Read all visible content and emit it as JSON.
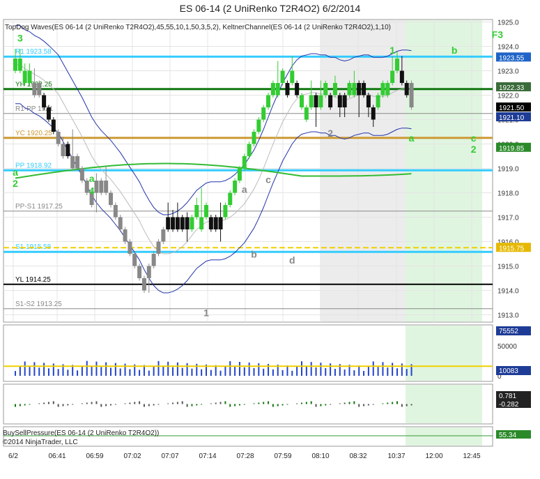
{
  "title": "ES 06-14 (2 UniRenko T2R4O2)  6/2/2014",
  "indicator_label": "TopDog Waves(ES 06-14 (2 UniRenko T2R4O2),45,55,10,1,50,3,5,2), KeltnerChannel(ES 06-14 (2 UniRenko T2R4O2),1,10)",
  "bsp_label": "BuySellPressure(ES 06-14 (2 UniRenko T2R4O2))",
  "copyright": "©2014 NinjaTrader, LLC",
  "colors": {
    "up_bar": "#33cc33",
    "down_bar": "#111111",
    "gray_bar": "#888888",
    "keltner": "#2233aa",
    "mid_line": "#777777",
    "green_ma": "#33bb33",
    "pivot_cyan": "#33ccff",
    "yc_orange": "#cc9933",
    "s1_yellow": "#f0d000",
    "volume_bar": "#2244cc",
    "session_shade": "#e0f5e0"
  },
  "chart_data": {
    "type": "candlestick",
    "title": "ES 06-14 (2 UniRenko T2R4O2)  6/2/2014",
    "x_ticks": [
      "6/2",
      "06:41",
      "06:59",
      "07:02",
      "07:07",
      "07:14",
      "07:28",
      "07:59",
      "08:10",
      "08:32",
      "10:37",
      "12:00",
      "12:45"
    ],
    "ylim": [
      1912.7,
      1925.1
    ],
    "y_ticks": [
      1913.0,
      1914.0,
      1915.0,
      1916.0,
      1917.0,
      1918.0,
      1919.0,
      1920.0,
      1921.0,
      1922.0,
      1923.0,
      1924.0,
      1925.0
    ],
    "grid": true,
    "price_bars": [
      {
        "o": 1923.0,
        "c": 1923.5,
        "h": 1923.9,
        "l": 1922.9,
        "dir": "up"
      },
      {
        "o": 1923.0,
        "c": 1923.5,
        "h": 1923.9,
        "l": 1922.9,
        "dir": "up"
      },
      {
        "o": 1922.5,
        "c": 1923.0,
        "h": 1923.3,
        "l": 1922.4,
        "dir": "up"
      },
      {
        "o": 1922.5,
        "c": 1923.0,
        "h": 1923.3,
        "l": 1922.4,
        "dir": "up"
      },
      {
        "o": 1922.0,
        "c": 1922.5,
        "h": 1923.1,
        "l": 1921.9,
        "dir": "gray"
      },
      {
        "o": 1922.0,
        "c": 1922.5,
        "h": 1922.6,
        "l": 1921.9,
        "dir": "gray"
      },
      {
        "o": 1921.5,
        "c": 1922.0,
        "h": 1922.1,
        "l": 1921.4,
        "dir": "down"
      },
      {
        "o": 1921.0,
        "c": 1921.5,
        "h": 1921.6,
        "l": 1920.9,
        "dir": "down"
      },
      {
        "o": 1920.5,
        "c": 1921.0,
        "h": 1921.1,
        "l": 1920.4,
        "dir": "down"
      },
      {
        "o": 1920.0,
        "c": 1920.5,
        "h": 1920.6,
        "l": 1919.9,
        "dir": "gray"
      },
      {
        "o": 1919.5,
        "c": 1920.0,
        "h": 1920.3,
        "l": 1919.4,
        "dir": "gray"
      },
      {
        "o": 1919.5,
        "c": 1920.0,
        "h": 1920.1,
        "l": 1919.4,
        "dir": "down"
      },
      {
        "o": 1919.0,
        "c": 1919.5,
        "h": 1920.6,
        "l": 1918.9,
        "dir": "gray"
      },
      {
        "o": 1919.0,
        "c": 1919.5,
        "h": 1919.6,
        "l": 1918.9,
        "dir": "gray"
      },
      {
        "o": 1918.5,
        "c": 1919.0,
        "h": 1919.1,
        "l": 1918.4,
        "dir": "gray"
      },
      {
        "o": 1918.0,
        "c": 1918.5,
        "h": 1918.6,
        "l": 1917.9,
        "dir": "gray"
      },
      {
        "o": 1917.5,
        "c": 1918.0,
        "h": 1918.1,
        "l": 1917.4,
        "dir": "gray"
      },
      {
        "o": 1918.0,
        "c": 1918.5,
        "h": 1918.8,
        "l": 1917.2,
        "dir": "gray"
      },
      {
        "o": 1918.0,
        "c": 1918.5,
        "h": 1918.6,
        "l": 1917.9,
        "dir": "gray"
      },
      {
        "o": 1918.0,
        "c": 1918.5,
        "h": 1919.1,
        "l": 1917.9,
        "dir": "gray"
      },
      {
        "o": 1917.5,
        "c": 1918.0,
        "h": 1918.1,
        "l": 1917.4,
        "dir": "gray"
      },
      {
        "o": 1917.0,
        "c": 1917.5,
        "h": 1917.6,
        "l": 1916.9,
        "dir": "gray"
      },
      {
        "o": 1916.5,
        "c": 1917.0,
        "h": 1917.1,
        "l": 1916.4,
        "dir": "gray"
      },
      {
        "o": 1916.0,
        "c": 1916.5,
        "h": 1916.6,
        "l": 1915.9,
        "dir": "gray"
      },
      {
        "o": 1915.5,
        "c": 1916.0,
        "h": 1916.1,
        "l": 1915.4,
        "dir": "gray"
      },
      {
        "o": 1915.0,
        "c": 1915.5,
        "h": 1915.6,
        "l": 1914.9,
        "dir": "gray"
      },
      {
        "o": 1914.5,
        "c": 1915.0,
        "h": 1915.1,
        "l": 1914.4,
        "dir": "gray"
      },
      {
        "o": 1914.0,
        "c": 1914.5,
        "h": 1914.6,
        "l": 1913.9,
        "dir": "gray"
      },
      {
        "o": 1914.5,
        "c": 1915.0,
        "h": 1915.1,
        "l": 1913.9,
        "dir": "gray"
      },
      {
        "o": 1915.0,
        "c": 1915.5,
        "h": 1915.6,
        "l": 1914.9,
        "dir": "gray"
      },
      {
        "o": 1915.5,
        "c": 1916.0,
        "h": 1916.1,
        "l": 1915.4,
        "dir": "gray"
      },
      {
        "o": 1916.0,
        "c": 1916.5,
        "h": 1916.6,
        "l": 1915.9,
        "dir": "gray"
      },
      {
        "o": 1916.5,
        "c": 1917.0,
        "h": 1917.6,
        "l": 1916.4,
        "dir": "down"
      },
      {
        "o": 1916.5,
        "c": 1917.0,
        "h": 1917.3,
        "l": 1916.4,
        "dir": "down"
      },
      {
        "o": 1916.5,
        "c": 1917.0,
        "h": 1917.6,
        "l": 1916.4,
        "dir": "down"
      },
      {
        "o": 1916.5,
        "c": 1917.0,
        "h": 1917.1,
        "l": 1916.4,
        "dir": "down"
      },
      {
        "o": 1916.5,
        "c": 1917.0,
        "h": 1917.2,
        "l": 1916.0,
        "dir": "down"
      },
      {
        "o": 1916.5,
        "c": 1917.0,
        "h": 1917.1,
        "l": 1916.4,
        "dir": "up"
      },
      {
        "o": 1917.0,
        "c": 1917.5,
        "h": 1917.8,
        "l": 1916.9,
        "dir": "up"
      },
      {
        "o": 1916.5,
        "c": 1917.0,
        "h": 1918.2,
        "l": 1916.4,
        "dir": "up"
      },
      {
        "o": 1917.0,
        "c": 1917.5,
        "h": 1917.6,
        "l": 1916.9,
        "dir": "up"
      },
      {
        "o": 1916.5,
        "c": 1917.0,
        "h": 1917.1,
        "l": 1916.4,
        "dir": "down"
      },
      {
        "o": 1916.5,
        "c": 1917.0,
        "h": 1917.1,
        "l": 1916.4,
        "dir": "down"
      },
      {
        "o": 1916.5,
        "c": 1917.0,
        "h": 1917.6,
        "l": 1916.0,
        "dir": "down"
      },
      {
        "o": 1917.0,
        "c": 1917.5,
        "h": 1917.6,
        "l": 1916.9,
        "dir": "up"
      },
      {
        "o": 1917.5,
        "c": 1918.0,
        "h": 1918.1,
        "l": 1917.4,
        "dir": "up"
      },
      {
        "o": 1918.0,
        "c": 1918.5,
        "h": 1918.6,
        "l": 1917.9,
        "dir": "up"
      },
      {
        "o": 1918.5,
        "c": 1919.0,
        "h": 1919.1,
        "l": 1918.4,
        "dir": "up"
      },
      {
        "o": 1919.0,
        "c": 1919.5,
        "h": 1919.6,
        "l": 1918.9,
        "dir": "up"
      },
      {
        "o": 1919.5,
        "c": 1920.0,
        "h": 1920.1,
        "l": 1919.4,
        "dir": "up"
      },
      {
        "o": 1920.0,
        "c": 1920.5,
        "h": 1920.6,
        "l": 1919.9,
        "dir": "up"
      },
      {
        "o": 1920.5,
        "c": 1921.0,
        "h": 1921.1,
        "l": 1920.4,
        "dir": "up"
      },
      {
        "o": 1921.0,
        "c": 1921.5,
        "h": 1921.6,
        "l": 1920.9,
        "dir": "up"
      },
      {
        "o": 1921.5,
        "c": 1922.0,
        "h": 1922.1,
        "l": 1921.4,
        "dir": "up"
      },
      {
        "o": 1922.0,
        "c": 1922.5,
        "h": 1922.6,
        "l": 1921.9,
        "dir": "up"
      },
      {
        "o": 1922.0,
        "c": 1922.5,
        "h": 1923.4,
        "l": 1921.9,
        "dir": "up"
      },
      {
        "o": 1922.5,
        "c": 1923.0,
        "h": 1923.1,
        "l": 1922.4,
        "dir": "up"
      },
      {
        "o": 1922.0,
        "c": 1922.5,
        "h": 1922.6,
        "l": 1921.9,
        "dir": "down"
      },
      {
        "o": 1922.5,
        "c": 1923.0,
        "h": 1923.6,
        "l": 1922.4,
        "dir": "up"
      },
      {
        "o": 1922.0,
        "c": 1922.5,
        "h": 1922.6,
        "l": 1921.9,
        "dir": "down"
      },
      {
        "o": 1921.5,
        "c": 1922.0,
        "h": 1922.1,
        "l": 1921.4,
        "dir": "up"
      },
      {
        "o": 1921.0,
        "c": 1921.5,
        "h": 1921.6,
        "l": 1920.9,
        "dir": "up"
      },
      {
        "o": 1921.5,
        "c": 1922.0,
        "h": 1922.6,
        "l": 1921.4,
        "dir": "up"
      },
      {
        "o": 1921.5,
        "c": 1922.0,
        "h": 1922.1,
        "l": 1920.7,
        "dir": "down"
      },
      {
        "o": 1921.5,
        "c": 1922.0,
        "h": 1922.6,
        "l": 1921.4,
        "dir": "up"
      },
      {
        "o": 1922.0,
        "c": 1922.5,
        "h": 1922.6,
        "l": 1921.9,
        "dir": "up"
      },
      {
        "o": 1921.5,
        "c": 1922.0,
        "h": 1922.1,
        "l": 1921.4,
        "dir": "down"
      },
      {
        "o": 1922.0,
        "c": 1922.5,
        "h": 1922.8,
        "l": 1921.9,
        "dir": "up"
      },
      {
        "o": 1921.5,
        "c": 1922.0,
        "h": 1922.1,
        "l": 1921.1,
        "dir": "down"
      },
      {
        "o": 1921.5,
        "c": 1922.0,
        "h": 1922.1,
        "l": 1921.1,
        "dir": "down"
      },
      {
        "o": 1922.0,
        "c": 1922.5,
        "h": 1922.6,
        "l": 1921.9,
        "dir": "up"
      },
      {
        "o": 1922.0,
        "c": 1922.5,
        "h": 1923.0,
        "l": 1921.9,
        "dir": "up"
      },
      {
        "o": 1922.0,
        "c": 1922.5,
        "h": 1922.6,
        "l": 1921.1,
        "dir": "down"
      },
      {
        "o": 1922.0,
        "c": 1922.5,
        "h": 1922.6,
        "l": 1921.9,
        "dir": "down"
      },
      {
        "o": 1921.5,
        "c": 1922.0,
        "h": 1922.1,
        "l": 1921.1,
        "dir": "down"
      },
      {
        "o": 1921.0,
        "c": 1921.5,
        "h": 1921.6,
        "l": 1920.7,
        "dir": "down"
      },
      {
        "o": 1921.5,
        "c": 1922.0,
        "h": 1922.1,
        "l": 1921.4,
        "dir": "up"
      },
      {
        "o": 1922.0,
        "c": 1922.5,
        "h": 1922.6,
        "l": 1921.9,
        "dir": "up"
      },
      {
        "o": 1922.0,
        "c": 1922.5,
        "h": 1922.6,
        "l": 1921.9,
        "dir": "up"
      },
      {
        "o": 1922.5,
        "c": 1923.0,
        "h": 1923.6,
        "l": 1922.4,
        "dir": "up"
      },
      {
        "o": 1923.0,
        "c": 1923.5,
        "h": 1923.8,
        "l": 1922.9,
        "dir": "up"
      },
      {
        "o": 1922.5,
        "c": 1923.0,
        "h": 1923.6,
        "l": 1922.4,
        "dir": "down"
      },
      {
        "o": 1922.0,
        "c": 1922.5,
        "h": 1922.6,
        "l": 1921.9,
        "dir": "down"
      },
      {
        "o": 1921.5,
        "c": 1922.5,
        "h": 1922.6,
        "l": 1921.4,
        "dir": "gray"
      }
    ],
    "horizontal_lines": [
      {
        "label": "R1 1923.58",
        "value": 1923.58,
        "color": "#33ccff"
      },
      {
        "label": "YH 1922.25",
        "value": 1922.25,
        "color": "#117711"
      },
      {
        "label": "R1-PP 1921",
        "value": 1921.25,
        "color": "#888888"
      },
      {
        "label": "YC 1920.25",
        "value": 1920.25,
        "color": "#cc9933"
      },
      {
        "label": "PP 1918.92",
        "value": 1918.92,
        "color": "#33ccff"
      },
      {
        "label": "PP-S1 1917.25",
        "value": 1917.25,
        "color": "#888888"
      },
      {
        "label": "S1 1915.58",
        "value": 1915.58,
        "color": "#33ccff"
      },
      {
        "label": "",
        "value": 1915.75,
        "color": "#f0d000"
      },
      {
        "label": "YL 1914.25",
        "value": 1914.25,
        "color": "#000000"
      },
      {
        "label": "S1-S2 1913.25",
        "value": 1913.25,
        "color": "#888888"
      }
    ],
    "price_tags": [
      {
        "value": 1923.55,
        "text": "1923.55",
        "bg": "#1e64c8"
      },
      {
        "value": 1922.33,
        "text": "1922.33",
        "bg": "#3a6b3a"
      },
      {
        "value": 1921.5,
        "text": "1921.50",
        "bg": "#000000"
      },
      {
        "value": 1921.1,
        "text": "1921.10",
        "bg": "#1e3c96"
      },
      {
        "value": 1919.85,
        "text": "1919.85",
        "bg": "#2a8a2a"
      },
      {
        "value": 1915.75,
        "text": "1915.75",
        "bg": "#e6b800"
      }
    ],
    "wave_labels": [
      {
        "text": "3",
        "bar": 1,
        "price": 1924.2,
        "color": "#33cc33"
      },
      {
        "text": "a",
        "bar": 0,
        "price": 1918.7,
        "color": "#33cc33"
      },
      {
        "text": "2",
        "bar": 0,
        "price": 1918.25,
        "color": "#33cc33"
      },
      {
        "text": "a",
        "bar": 16,
        "price": 1918.45,
        "color": "#33cc33"
      },
      {
        "text": "4",
        "bar": 16,
        "price": 1917.95,
        "color": "#33cc33"
      },
      {
        "text": "1",
        "bar": 40,
        "price": 1912.95,
        "color": "#888888"
      },
      {
        "text": "a",
        "bar": 48,
        "price": 1918.0,
        "color": "#888888"
      },
      {
        "text": "b",
        "bar": 50,
        "price": 1915.35,
        "color": "#888888"
      },
      {
        "text": "c",
        "bar": 53,
        "price": 1918.4,
        "color": "#888888"
      },
      {
        "text": "d",
        "bar": 58,
        "price": 1915.1,
        "color": "#888888"
      },
      {
        "text": "2",
        "bar": 66,
        "price": 1920.3,
        "color": "#888888"
      },
      {
        "text": "1",
        "bar": 79,
        "price": 1923.7,
        "color": "#33cc33"
      },
      {
        "text": "a",
        "bar": 83,
        "price": 1920.1,
        "color": "#33cc33"
      },
      {
        "text": "b",
        "bar": 92,
        "price": 1923.7,
        "color": "#33cc33"
      },
      {
        "text": "c",
        "bar": 96,
        "price": 1920.1,
        "color": "#33cc33"
      },
      {
        "text": "2",
        "bar": 96,
        "price": 1919.65,
        "color": "#33cc33"
      },
      {
        "text": "F3",
        "bar": 101,
        "price": 1924.35,
        "color": "#33cc33"
      }
    ],
    "volume": {
      "ylim": [
        0,
        80000
      ],
      "y_ticks": [
        0,
        50000
      ],
      "tags": [
        "75552",
        "10083"
      ]
    },
    "pressure": {
      "tags": [
        "0.781",
        "-0.282"
      ]
    },
    "bsp": {
      "tags": [
        "55.34"
      ]
    }
  }
}
